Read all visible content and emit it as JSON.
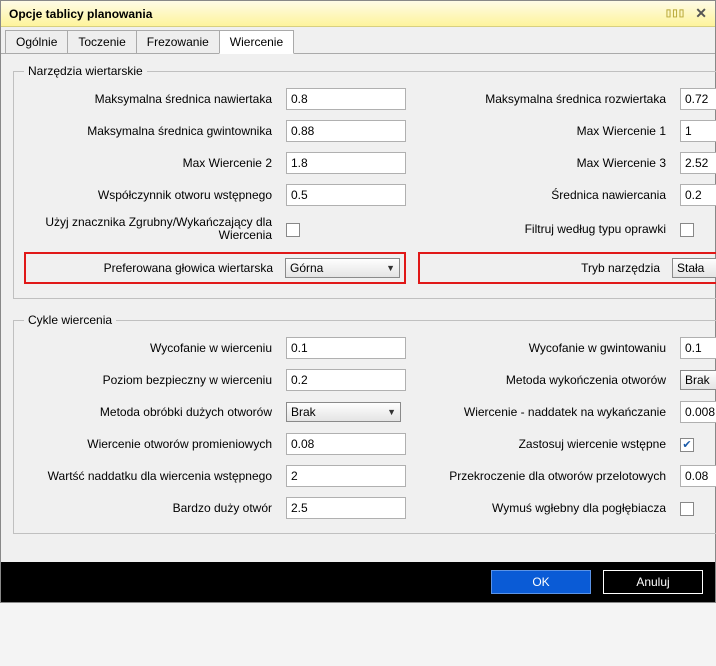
{
  "title": "Opcje tablicy planowania",
  "tabs": {
    "general": "Ogólnie",
    "turning": "Toczenie",
    "milling": "Frezowanie",
    "drilling": "Wiercenie"
  },
  "group1": {
    "legend": "Narzędzia wiertarskie",
    "labels": {
      "maxSpot": "Maksymalna średnica nawiertaka",
      "maxReamer": "Maksymalna średnica rozwiertaka",
      "maxTap": "Maksymalna średnica gwintownika",
      "maxDrill1": "Max Wiercenie 1",
      "maxDrill2": "Max Wiercenie 2",
      "maxDrill3": "Max Wiercenie 3",
      "pilotFactor": "Współczynnik otworu wstępnego",
      "spotDia": "Średnica nawiercania",
      "roughFinish": "Użyj znacznika Zgrubny/Wykańczający dla Wiercenia",
      "filterHolder": "Filtruj według typu oprawki",
      "prefHead": "Preferowana głowica wiertarska",
      "toolMode": "Tryb narzędzia"
    },
    "values": {
      "maxSpot": "0.8",
      "maxReamer": "0.72",
      "maxTap": "0.88",
      "maxDrill1": "1",
      "maxDrill2": "1.8",
      "maxDrill3": "2.52",
      "pilotFactor": "0.5",
      "spotDia": "0.2",
      "prefHead": "Górna",
      "toolMode": "Stała"
    }
  },
  "group2": {
    "legend": "Cykle wiercenia",
    "labels": {
      "retractDrill": "Wycofanie w wierceniu",
      "retractTap": "Wycofanie w gwintowaniu",
      "safeLevel": "Poziom bezpieczny w wierceniu",
      "finishMethod": "Metoda wykończenia otworów",
      "bigHoleMethod": "Metoda obróbki dużych otworów",
      "finishAllowLabel": "Wiercenie - naddatek na wykańczanie",
      "radialDrill": "Wiercenie otworów promieniowych",
      "applyPilot": "Zastosuj wiercenie wstępne",
      "pilotAllow": "Wartść naddatku dla wiercenia wstępnego",
      "throughOver": "Przekroczenie dla otworów przelotowych",
      "veryBig": "Bardzo duży otwór",
      "forceDeep": "Wymuś wgłebny dla pogłębiacza"
    },
    "values": {
      "retractDrill": "0.1",
      "retractTap": "0.1",
      "safeLevel": "0.2",
      "finishMethod": "Brak",
      "bigHoleMethod": "Brak",
      "finishAllow": "0.008",
      "radialDrill": "0.08",
      "pilotAllow": "2",
      "throughOver": "0.08",
      "veryBig": "2.5"
    }
  },
  "buttons": {
    "ok": "OK",
    "cancel": "Anuluj"
  }
}
